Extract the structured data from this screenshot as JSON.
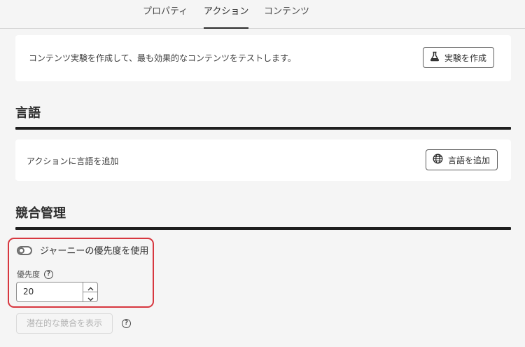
{
  "tabs": [
    {
      "label": "プロパティ",
      "active": false
    },
    {
      "label": "アクション",
      "active": true
    },
    {
      "label": "コンテンツ",
      "active": false
    }
  ],
  "experiment": {
    "description": "コンテンツ実験を作成して、最も効果的なコンテンツをテストします。",
    "button_label": "実験を作成",
    "button_icon": "flask-icon"
  },
  "language": {
    "section_title": "言語",
    "description": "アクションに言語を追加",
    "button_label": "言語を追加",
    "button_icon": "globe-icon"
  },
  "arbitration": {
    "section_title": "競合管理",
    "toggle_label": "ジャーニーの優先度を使用",
    "toggle_on": false,
    "priority_label": "優先度",
    "priority_value": "20",
    "show_conflicts_label": "潜在的な競合を表示",
    "help_glyph": "?"
  },
  "colors": {
    "highlight": "#d7373f",
    "background": "#f5f5f5"
  }
}
